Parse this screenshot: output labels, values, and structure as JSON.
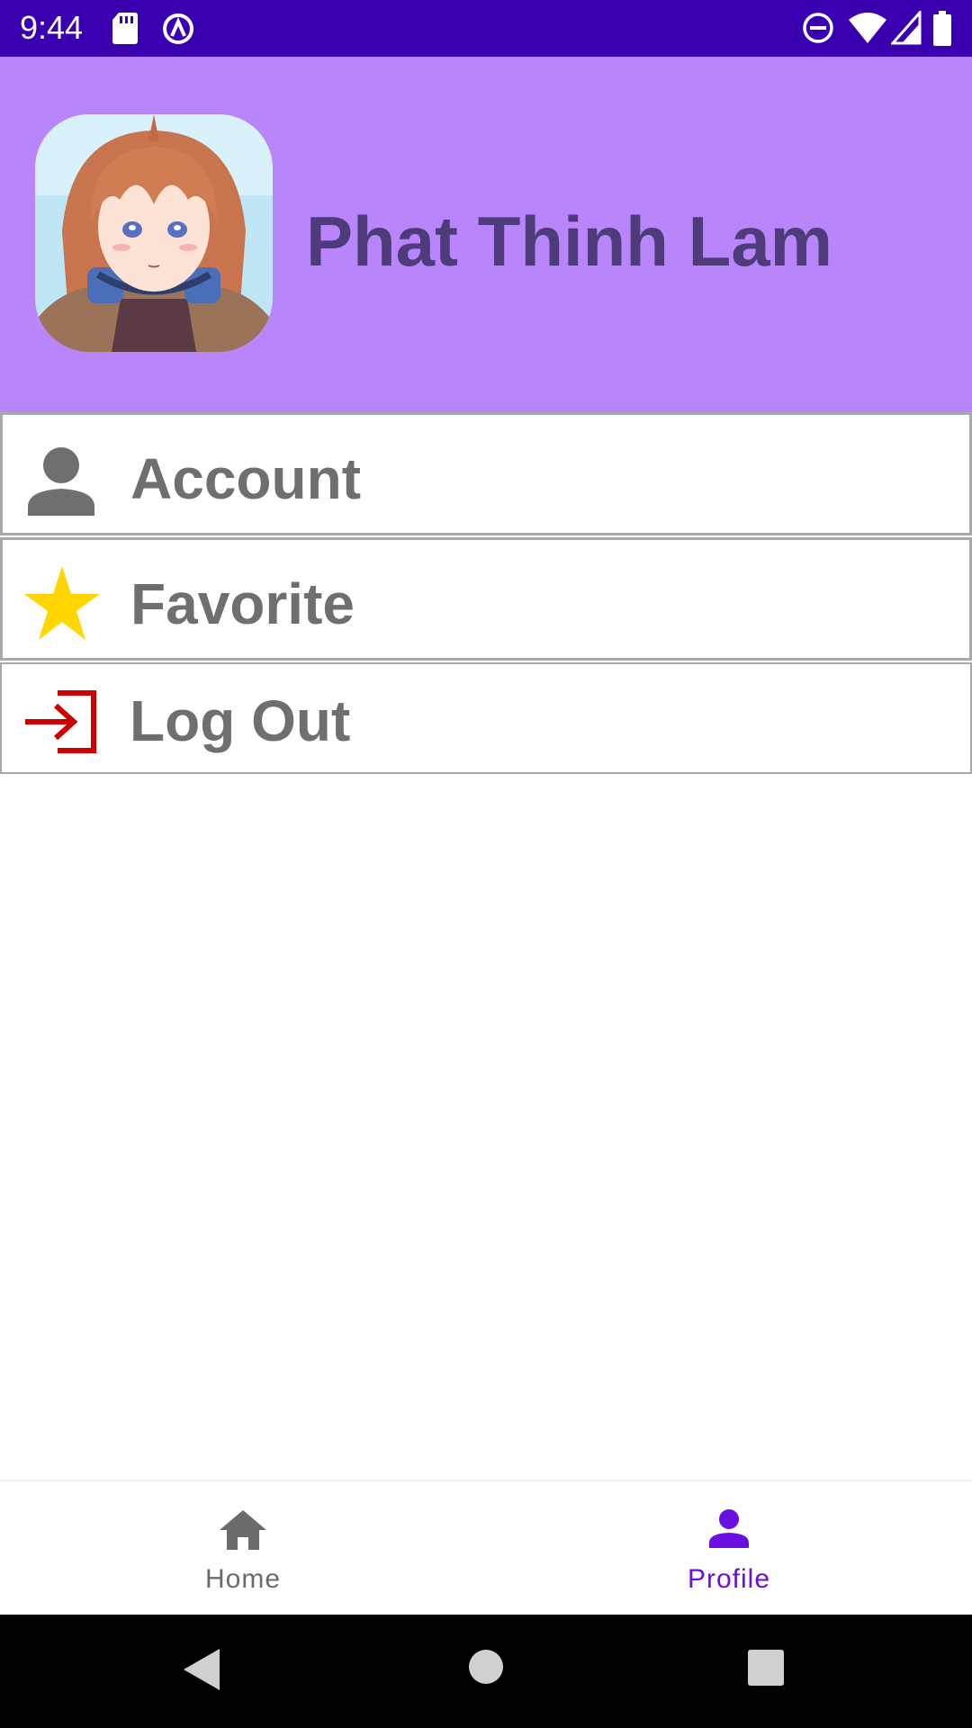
{
  "status_bar": {
    "time": "9:44",
    "icons": [
      "sd-card-icon",
      "sync-icon",
      "do-not-disturb-icon",
      "wifi-icon",
      "signal-icon",
      "battery-icon"
    ]
  },
  "header": {
    "name": "Phat Thinh Lam",
    "background_color": "#b985fb",
    "name_color": "#4e3b7a"
  },
  "menu": {
    "items": [
      {
        "label": "Account",
        "icon": "person-icon",
        "icon_color": "#6f6f6f"
      },
      {
        "label": "Favorite",
        "icon": "star-icon",
        "icon_color": "#ffd600"
      },
      {
        "label": "Log Out",
        "icon": "logout-icon",
        "icon_color": "#cc0000"
      }
    ]
  },
  "bottom_nav": {
    "items": [
      {
        "label": "Home",
        "icon": "home-icon",
        "selected": false
      },
      {
        "label": "Profile",
        "icon": "person-icon",
        "selected": true
      }
    ],
    "active_color": "#6a0fe0"
  },
  "system_nav": {
    "buttons": [
      "back-icon",
      "home-circle-icon",
      "recents-icon"
    ]
  }
}
